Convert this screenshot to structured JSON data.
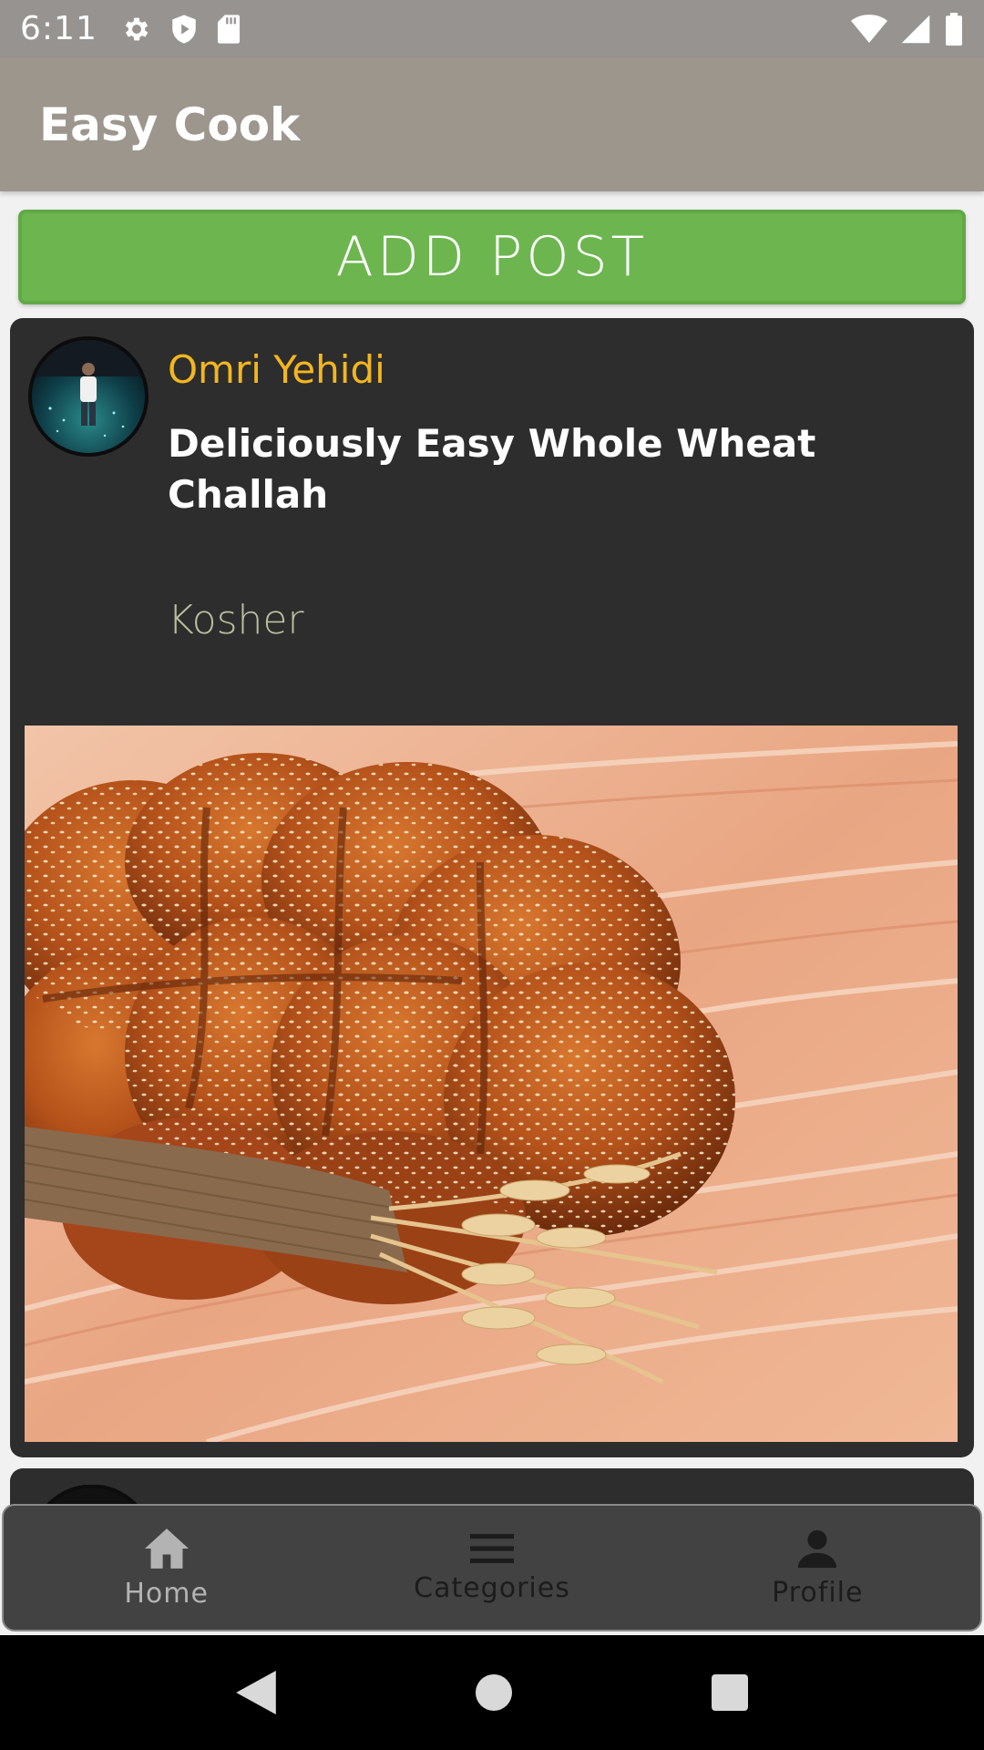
{
  "status_bar": {
    "time": "6:11",
    "left_icons": [
      "gear-icon",
      "shield-icon",
      "sd-card-icon"
    ],
    "right_icons": [
      "wifi-icon",
      "signal-icon",
      "battery-icon"
    ]
  },
  "app_bar": {
    "title": "Easy Cook"
  },
  "add_post_button": {
    "label": "ADD POST"
  },
  "posts": [
    {
      "author": "Omri Yehidi",
      "title": "Deliciously Easy Whole Wheat Challah",
      "category": "Kosher",
      "avatar_icon": "user-avatar",
      "image": "braided-challah-bread-photo"
    }
  ],
  "bottom_nav": {
    "items": [
      {
        "label": "Home",
        "icon": "home-icon",
        "active": true
      },
      {
        "label": "Categories",
        "icon": "menu-icon",
        "active": false
      },
      {
        "label": "Profile",
        "icon": "person-icon",
        "active": false
      }
    ]
  },
  "colors": {
    "status_bar": "#969391",
    "app_bar": "#9c968d",
    "add_post": "#6db64f",
    "card": "#2d2d2d",
    "author": "#f3b61f",
    "category": "#b9c09d",
    "bottom_nav": "#434242"
  }
}
